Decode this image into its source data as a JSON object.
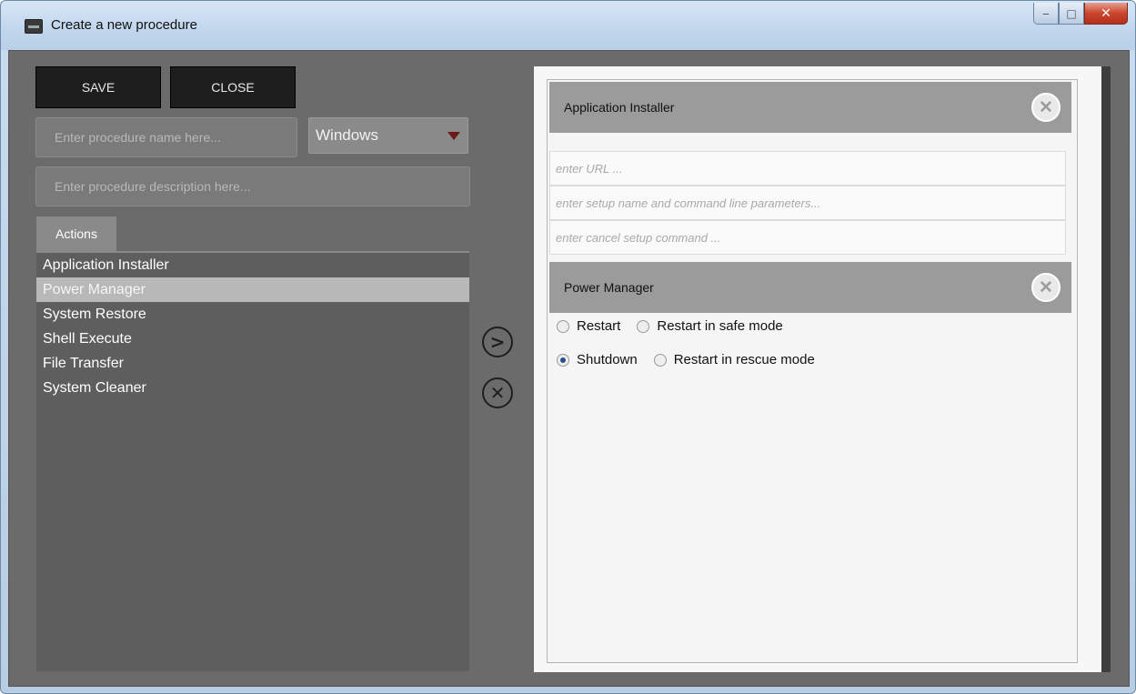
{
  "window": {
    "title": "Create a new procedure",
    "minimize": "‒",
    "maximize": "□",
    "close": "✕"
  },
  "toolbar": {
    "save_label": "SAVE",
    "close_label": "CLOSE"
  },
  "form": {
    "name_placeholder": "Enter procedure name here...",
    "os_selected": "Windows",
    "description_placeholder": "Enter procedure description here..."
  },
  "actions": {
    "tab_label": "Actions",
    "items": [
      {
        "label": "Application Installer"
      },
      {
        "label": "Power Manager",
        "selected": true
      },
      {
        "label": "System Restore"
      },
      {
        "label": "Shell Execute"
      },
      {
        "label": "File Transfer"
      },
      {
        "label": "System Cleaner"
      }
    ]
  },
  "controls": {
    "add_glyph": ">",
    "remove_glyph": "✕"
  },
  "procedure": {
    "app_installer": {
      "title": "Application Installer",
      "close_glyph": "✕",
      "url_placeholder": "enter URL ...",
      "setup_placeholder": "enter setup name and command line parameters...",
      "cancel_placeholder": "enter cancel setup command ..."
    },
    "power_manager": {
      "title": "Power Manager",
      "close_glyph": "✕",
      "options": {
        "restart": "Restart",
        "restart_safe": "Restart in safe mode",
        "shutdown": "Shutdown",
        "restart_rescue": "Restart in rescue mode"
      },
      "selected": "Shutdown"
    }
  },
  "colors": {
    "client_bg": "#6b6b6b",
    "button_dark": "#1e1e1e",
    "header_bg": "#9b9b9b",
    "radio_checked": "#2b4f8c"
  }
}
